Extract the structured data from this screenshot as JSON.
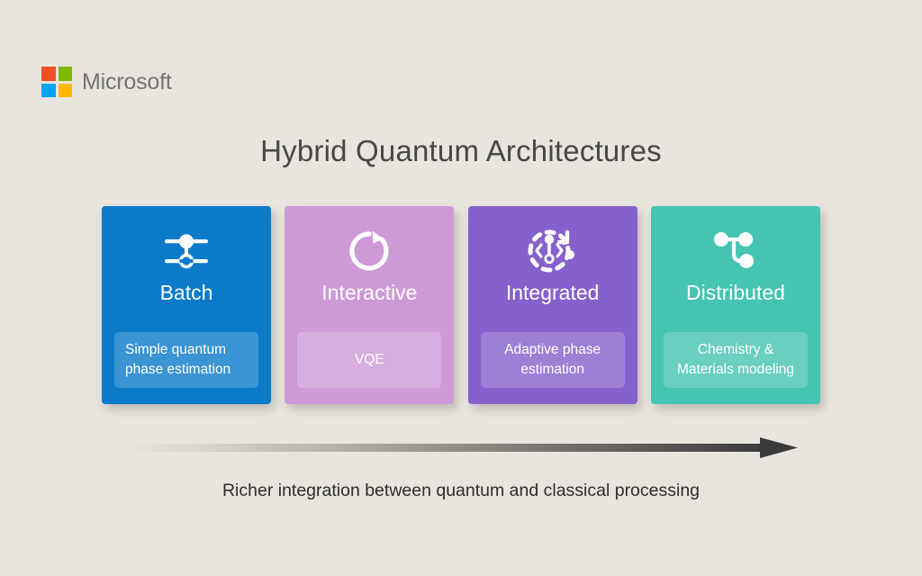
{
  "brand": {
    "name": "Microsoft",
    "logo_icon": "microsoft-squares-icon",
    "square_colors": [
      "#f25022",
      "#7fba00",
      "#00a4ef",
      "#ffb900"
    ]
  },
  "slide": {
    "background_color": "#e8e4de",
    "title": "Hybrid Quantum Architectures",
    "title_color": "#474747"
  },
  "cards": [
    {
      "heading": "Batch",
      "tag": "Simple quantum phase estimation",
      "color": "#0b7ac8",
      "icon": "cnot-gate-icon",
      "tag_align": "align-left"
    },
    {
      "heading": "Interactive",
      "tag": "VQE",
      "color": "#cd9ad7",
      "icon": "refresh-loop-icon",
      "tag_align": "align-center"
    },
    {
      "heading": "Integrated",
      "tag": "Adaptive phase estimation",
      "color": "#8660cc",
      "icon": "adaptive-circuit-icon",
      "tag_align": "align-center"
    },
    {
      "heading": "Distributed",
      "tag": "Chemistry & Materials modeling",
      "color": "#45c4b0",
      "icon": "node-graph-icon",
      "tag_align": "align-center"
    }
  ],
  "progression": {
    "arrow_icon": "gradient-right-arrow-icon",
    "arrow_color_start": "#e8e4de",
    "arrow_color_end": "#3a3a3a",
    "caption": "Richer integration between quantum and classical processing"
  }
}
